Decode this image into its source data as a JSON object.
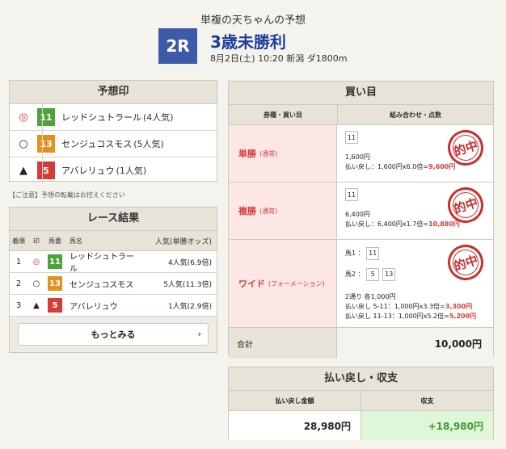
{
  "header": {
    "subtitle": "単複の天ちゃんの予想",
    "race_no": "2R",
    "race_name": "3歳未勝利",
    "race_info": "8月2日(土) 10:20 新潟 ダ1800m"
  },
  "prediction": {
    "title": "予想印",
    "rows": [
      {
        "mark": "◎",
        "num": "11",
        "name": "レッドシュトラール",
        "pop": "(4人気)",
        "color": "#4ba33a"
      },
      {
        "mark": "○",
        "num": "13",
        "name": "センジュコスモス",
        "pop": "(5人気)",
        "color": "#e5901d"
      },
      {
        "mark": "▲",
        "num": "5",
        "name": "アバレリュウ",
        "pop": "(1人気)",
        "color": "#d83a3a"
      }
    ]
  },
  "notice": "【ご注意】予想の転載はお控えください",
  "results": {
    "title": "レース結果",
    "headers": {
      "rank": "着順",
      "mark": "印",
      "num": "馬番",
      "name": "馬名",
      "pop": "人気(単勝オッズ)"
    },
    "rows": [
      {
        "rank": "1",
        "mark": "◎",
        "num": "11",
        "name": "レッドシュトラール",
        "pop": "4人気(6.9倍)"
      },
      {
        "rank": "2",
        "mark": "○",
        "num": "13",
        "name": "センジュコスモス",
        "pop": "5人気(11.3倍)"
      },
      {
        "rank": "3",
        "mark": "▲",
        "num": "5",
        "name": "アバレリュウ",
        "pop": "1人気(2.9倍)"
      }
    ],
    "more_label": "もっとみる"
  },
  "purchase": {
    "title": "買い目",
    "col_type": "券種・買い目",
    "col_combo": "組み合わせ・点数",
    "stamp_text": "的中",
    "win": {
      "type": "単勝",
      "sub": "(通常)",
      "num": "11",
      "amount": "1,600円",
      "refund_prefix": "払い戻し：1,600円x6.0倍=",
      "refund_value": "9,600円"
    },
    "place": {
      "type": "複勝",
      "sub": "(通常)",
      "num": "11",
      "amount": "6,400円",
      "refund_prefix": "払い戻し：6,400円x1.7倍=",
      "refund_value": "10,880円"
    },
    "wide": {
      "type": "ワイド",
      "sub": "(フォーメーション)",
      "h1_label": "馬1",
      "h1_nums": [
        "11"
      ],
      "h2_label": "馬2",
      "h2_nums": [
        "5",
        "13"
      ],
      "count": "2通り 各1,000円",
      "r1_prefix": "払い戻し 5-11：1,000円x3.3倍=",
      "r1_value": "3,300円",
      "r2_prefix": "払い戻し 11-13：1,000円x5.2倍=",
      "r2_value": "5,200円"
    },
    "total_label": "合計",
    "total_value": "10,000円"
  },
  "payout": {
    "title": "払い戻し・収支",
    "col_refund": "払い戻し金額",
    "col_balance": "収支",
    "refund_value": "28,980円",
    "balance_value": "+18,980円"
  }
}
